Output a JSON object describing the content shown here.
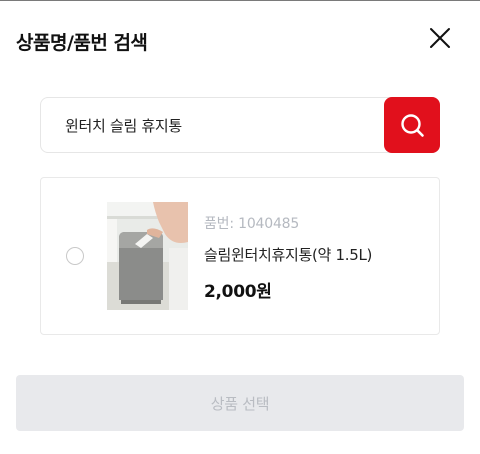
{
  "modal": {
    "title": "상품명/품번 검색",
    "close_icon": "close-icon"
  },
  "search": {
    "value": "윈터치 슬림 휴지통",
    "button_icon": "search-icon",
    "button_color": "#e1101c"
  },
  "results": [
    {
      "code": "품번: 1040485",
      "name": "슬림윈터치휴지통(약 1.5L)",
      "price": "2,000원",
      "image": "slim-touch-trash-can-photo",
      "selected": false
    }
  ],
  "footer": {
    "select_label": "상품 선택",
    "disabled": true
  }
}
